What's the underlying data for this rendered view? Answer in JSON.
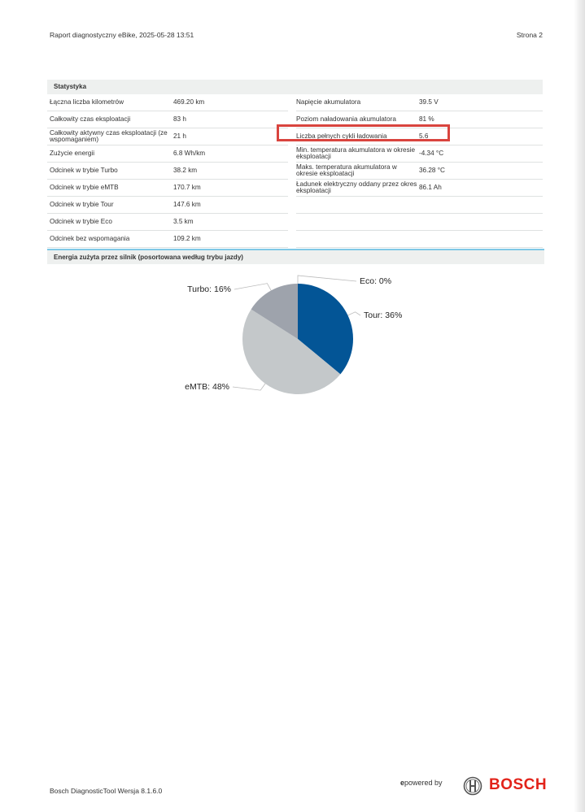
{
  "header": {
    "report_title": "Raport diagnostyczny eBike, 2025-05-28 13:51",
    "page_label": "Strona 2"
  },
  "stats": {
    "title": "Statystyka",
    "rows": [
      {
        "l1": "Łączna liczba kilometrów",
        "v1": "469.20 km",
        "l2": "Napięcie akumulatora",
        "v2": "39.5 V"
      },
      {
        "l1": "Całkowity czas eksploatacji",
        "v1": "83 h",
        "l2": "Poziom naładowania akumulatora",
        "v2": "81 %"
      },
      {
        "l1": "Całkowity aktywny czas eksploatacji (ze wspomaganiem)",
        "v1": "21 h",
        "l2": "Liczba pełnych cykli ładowania",
        "v2": "5.6"
      },
      {
        "l1": "Zużycie energii",
        "v1": "6.8 Wh/km",
        "l2": "Min. temperatura akumulatora w okresie eksploatacji",
        "v2": "-4.34 °C"
      },
      {
        "l1": "Odcinek w trybie Turbo",
        "v1": "38.2 km",
        "l2": "Maks. temperatura akumulatora w okresie eksploatacji",
        "v2": "36.28 °C"
      },
      {
        "l1": "Odcinek w trybie eMTB",
        "v1": "170.7 km",
        "l2": "Ładunek elektryczny oddany przez okres eksploatacji",
        "v2": "86.1 Ah"
      },
      {
        "l1": "Odcinek w trybie Tour",
        "v1": "147.6 km",
        "l2": "",
        "v2": ""
      },
      {
        "l1": "Odcinek w trybie Eco",
        "v1": "3.5 km",
        "l2": "",
        "v2": ""
      },
      {
        "l1": "Odcinek bez wspomagania",
        "v1": "109.2 km",
        "l2": "",
        "v2": ""
      }
    ]
  },
  "energy_section": {
    "title": "Energia zużyta przez silnik (posortowana według trybu jazdy)"
  },
  "chart_data": {
    "type": "pie",
    "categories": [
      "Eco",
      "Tour",
      "eMTB",
      "Turbo"
    ],
    "values": [
      0,
      36,
      48,
      16
    ],
    "labels": [
      "Eco: 0%",
      "Tour: 36%",
      "eMTB: 48%",
      "Turbo: 16%"
    ],
    "colors": [
      "#1b5e9a",
      "#035596",
      "#c4c8ca",
      "#9ea3ac"
    ]
  },
  "footer": {
    "tool_version": "Bosch DiagnosticTool Wersja 8.1.6.0",
    "powered_prefix": "e",
    "powered_text": "powered by",
    "brand": "BOSCH"
  }
}
